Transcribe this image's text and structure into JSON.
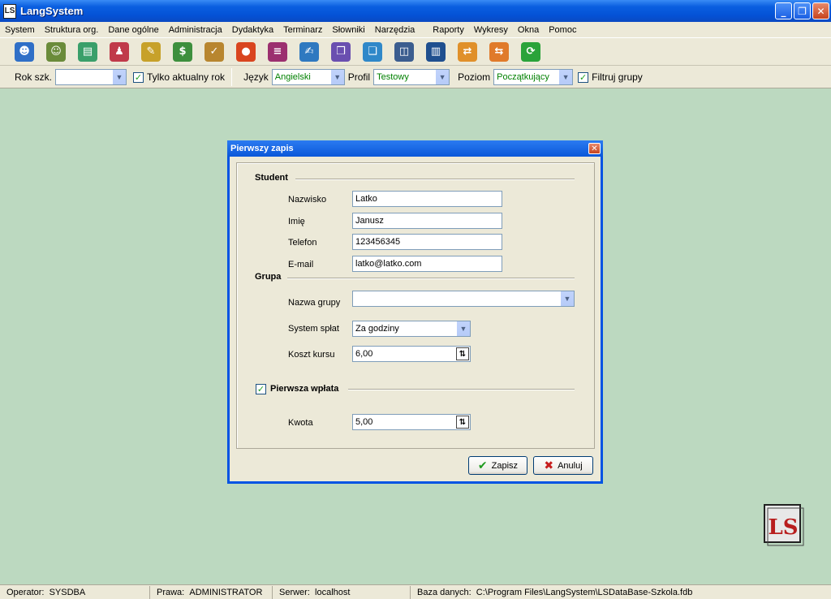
{
  "window": {
    "title": "LangSystem",
    "app_icon": "LS"
  },
  "menu": [
    "System",
    "Struktura org.",
    "Dane ogólne",
    "Administracja",
    "Dydaktyka",
    "Terminarz",
    "Słowniki",
    "Narzędzia",
    "Raporty",
    "Wykresy",
    "Okna",
    "Pomoc"
  ],
  "toolbar": [
    {
      "icon": "people-icon",
      "color": "#2f6fc7",
      "glyph": "☻"
    },
    {
      "icon": "user-icon",
      "color": "#6a8b3a",
      "glyph": "☺"
    },
    {
      "icon": "books-icon",
      "color": "#3a9f6a",
      "glyph": "▤"
    },
    {
      "icon": "teacher-icon",
      "color": "#c03a4a",
      "glyph": "♟"
    },
    {
      "icon": "note-icon",
      "color": "#c7a12a",
      "glyph": "✎"
    },
    {
      "icon": "money-icon",
      "color": "#3d8f3d",
      "glyph": "$"
    },
    {
      "icon": "clipboard-icon",
      "color": "#b8862f",
      "glyph": "✓"
    },
    {
      "icon": "disc-icon",
      "color": "#d9451f",
      "glyph": "●"
    },
    {
      "icon": "stack-icon",
      "color": "#9b2f6f",
      "glyph": "≡"
    },
    {
      "icon": "book-edit-icon",
      "color": "#2f79c0",
      "glyph": "✍"
    },
    {
      "icon": "book-icon",
      "color": "#6a4fb0",
      "glyph": "❒"
    },
    {
      "icon": "document-icon",
      "color": "#2f88c9",
      "glyph": "❏"
    },
    {
      "icon": "windows-icon",
      "color": "#3b5d8f",
      "glyph": "◫"
    },
    {
      "icon": "columns-icon",
      "color": "#1f4f8f",
      "glyph": "▥"
    },
    {
      "icon": "import-icon",
      "color": "#e0902a",
      "glyph": "⇄"
    },
    {
      "icon": "export-icon",
      "color": "#e07a2a",
      "glyph": "⇆"
    },
    {
      "icon": "refresh-icon",
      "color": "#2aa33a",
      "glyph": "⟳"
    }
  ],
  "filters": {
    "rok_label": "Rok szk.",
    "rok_value": "",
    "tylko_label": "Tylko aktualny rok",
    "jezyk_label": "Język",
    "jezyk_value": "Angielski",
    "profil_label": "Profil",
    "profil_value": "Testowy",
    "poziom_label": "Poziom",
    "poziom_value": "Początkujący",
    "filtruj_label": "Filtruj grupy"
  },
  "dialog": {
    "title": "Pierwszy zapis",
    "student_section": "Student",
    "nazwisko_label": "Nazwisko",
    "nazwisko_value": "Latko",
    "imie_label": "Imię",
    "imie_value": "Janusz",
    "telefon_label": "Telefon",
    "telefon_value": "123456345",
    "email_label": "E-mail",
    "email_value": "latko@latko.com",
    "grupa_section": "Grupa",
    "nazwa_grupy_label": "Nazwa grupy",
    "nazwa_grupy_value": "",
    "system_splat_label": "System spłat",
    "system_splat_value": "Za godziny",
    "koszt_label": "Koszt kursu",
    "koszt_value": "6,00",
    "pierwsza_wplata_label": "Pierwsza wpłata",
    "kwota_label": "Kwota",
    "kwota_value": "5,00",
    "save_label": "Zapisz",
    "cancel_label": "Anuluj"
  },
  "status": {
    "operator_label": "Operator:",
    "operator_value": "SYSDBA",
    "prawa_label": "Prawa:",
    "prawa_value": "ADMINISTRATOR",
    "serwer_label": "Serwer:",
    "serwer_value": "localhost",
    "baza_label": "Baza danych:",
    "baza_value": "C:\\Program Files\\LangSystem\\LSDataBase-Szkola.fdb"
  },
  "logo_text": "LS"
}
